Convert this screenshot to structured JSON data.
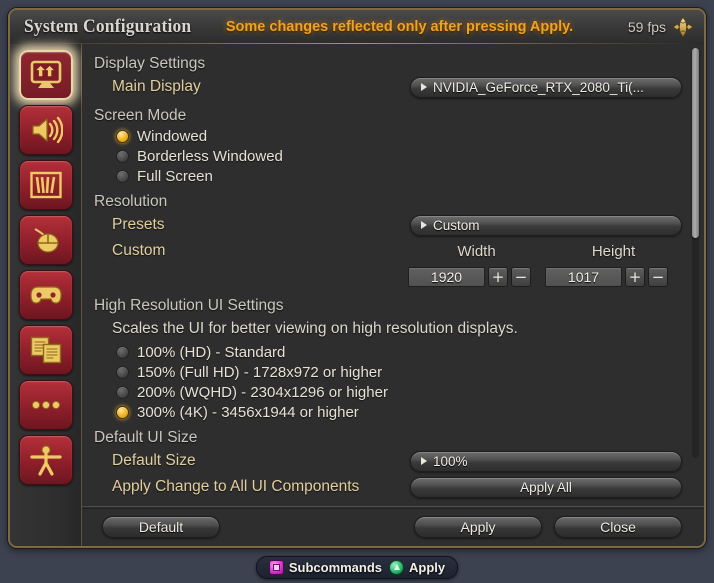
{
  "window": {
    "title": "System Configuration",
    "notice": "Some changes reflected only after pressing Apply.",
    "fps": "59 fps",
    "resize_icon": "resize-compass-icon"
  },
  "sidebar": {
    "items": [
      {
        "icon": "display-monitor-icon",
        "name": "display-settings",
        "active": true
      },
      {
        "icon": "speaker-sound-icon",
        "name": "sound-settings",
        "active": false
      },
      {
        "icon": "graphics-book-icon",
        "name": "graphics-settings",
        "active": false
      },
      {
        "icon": "mouse-icon",
        "name": "mouse-settings",
        "active": false
      },
      {
        "icon": "gamepad-icon",
        "name": "gamepad-settings",
        "active": false
      },
      {
        "icon": "windows-panels-icon",
        "name": "ui-window-settings",
        "active": false
      },
      {
        "icon": "three-dots-icon",
        "name": "other-settings",
        "active": false
      },
      {
        "icon": "person-accessibility-icon",
        "name": "accessibility-settings",
        "active": false
      }
    ]
  },
  "main": {
    "display_settings": {
      "heading": "Display Settings",
      "main_display_label": "Main Display",
      "main_display_value": "NVIDIA_GeForce_RTX_2080_Ti(..."
    },
    "screen_mode": {
      "heading": "Screen Mode",
      "options": [
        {
          "label": "Windowed",
          "selected": true
        },
        {
          "label": "Borderless Windowed",
          "selected": false
        },
        {
          "label": "Full Screen",
          "selected": false
        }
      ]
    },
    "resolution": {
      "heading": "Resolution",
      "presets_label": "Presets",
      "presets_value": "Custom",
      "custom_label": "Custom",
      "width_header": "Width",
      "height_header": "Height",
      "width_value": "1920",
      "height_value": "1017",
      "plus": "+",
      "minus": "−"
    },
    "high_res_ui": {
      "heading": "High Resolution UI Settings",
      "description": "Scales the UI for better viewing on high resolution displays.",
      "options": [
        {
          "label": "100% (HD) - Standard",
          "selected": false
        },
        {
          "label": "150% (Full HD) - 1728x972 or higher",
          "selected": false
        },
        {
          "label": "200% (WQHD) - 2304x1296 or higher",
          "selected": false
        },
        {
          "label": "300% (4K) - 3456x1944 or higher",
          "selected": true
        }
      ]
    },
    "default_ui_size": {
      "heading": "Default UI Size",
      "default_size_label": "Default Size",
      "default_size_value": "100%",
      "apply_all_label": "Apply Change to All UI Components",
      "apply_all_button": "Apply All"
    }
  },
  "buttons": {
    "default": "Default",
    "apply": "Apply",
    "close": "Close"
  },
  "footer": {
    "hints": [
      {
        "icon": "gamepad-square-button-icon",
        "label": "Subcommands"
      },
      {
        "icon": "gamepad-triangle-button-icon",
        "label": "Apply"
      }
    ]
  },
  "colors": {
    "accent_gold": "#e2cf9e",
    "notice_orange": "#f0a323",
    "radio_selected": "#f5b828",
    "frame_border": "#7d6a43",
    "sidebar_button_red": "#8e1f2a",
    "hint_square": "#d42fd0",
    "hint_triangle": "#24b469"
  }
}
